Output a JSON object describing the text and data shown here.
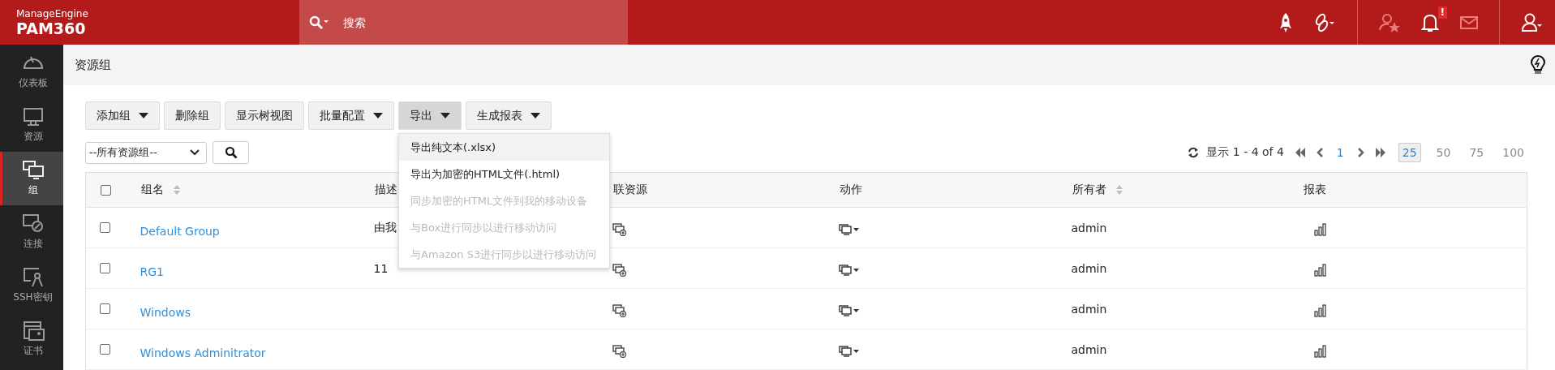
{
  "header": {
    "brand": "ManageEngine",
    "product": "PAM360",
    "search": {
      "placeholder": "搜索"
    },
    "alert_badge": "!"
  },
  "sidebar": {
    "items": [
      {
        "label": "仪表板",
        "selected": false
      },
      {
        "label": "资源",
        "selected": false
      },
      {
        "label": "组",
        "selected": true
      },
      {
        "label": "连接",
        "selected": false
      },
      {
        "label": "SSH密钥",
        "selected": false
      },
      {
        "label": "证书",
        "selected": false
      }
    ]
  },
  "page": {
    "title": "资源组"
  },
  "toolbar": {
    "buttons": [
      {
        "label": "添加组",
        "dropdown": true,
        "selected": false
      },
      {
        "label": "删除组",
        "dropdown": false,
        "selected": false
      },
      {
        "label": "显示树视图",
        "dropdown": false,
        "selected": false
      },
      {
        "label": "批量配置",
        "dropdown": true,
        "selected": false
      },
      {
        "label": "导出",
        "dropdown": true,
        "selected": true
      },
      {
        "label": "生成报表",
        "dropdown": true,
        "selected": false
      }
    ]
  },
  "export_menu": {
    "items": [
      {
        "label": "导出纯文本(.xlsx)",
        "disabled": false,
        "selected": true
      },
      {
        "label": "导出为加密的HTML文件(.html)",
        "disabled": false,
        "selected": false
      },
      {
        "label": "同步加密的HTML文件到我的移动设备",
        "disabled": true,
        "selected": false
      },
      {
        "label": "与Box进行同步以进行移动访问",
        "disabled": true,
        "selected": false
      },
      {
        "label": "与Amazon S3进行同步以进行移动访问",
        "disabled": true,
        "selected": false
      }
    ]
  },
  "filter": {
    "value": "--所有资源组--"
  },
  "pagination": {
    "range": "显示 1 - 4 of 4",
    "page": "1",
    "page_sizes": [
      {
        "label": "25",
        "selected": true
      },
      {
        "label": "50",
        "selected": false
      },
      {
        "label": "75",
        "selected": false
      },
      {
        "label": "100",
        "selected": false
      }
    ]
  },
  "table": {
    "select_all_checked": false,
    "columns": [
      {
        "label": "组名",
        "sortable": true
      },
      {
        "label": "描述",
        "sortable": false
      },
      {
        "label": "联资源",
        "sortable": false
      },
      {
        "label": "动作",
        "sortable": false
      },
      {
        "label": "所有者",
        "sortable": true
      },
      {
        "label": "报表",
        "sortable": false
      }
    ],
    "rows": [
      {
        "checked": false,
        "name": "Default Group",
        "description": "由我",
        "owner": "admin"
      },
      {
        "checked": false,
        "name": "RG1",
        "description": "11",
        "owner": "admin"
      },
      {
        "checked": false,
        "name": "Windows",
        "owner": "admin"
      },
      {
        "checked": false,
        "name": "Windows Adminitrator",
        "owner": "admin"
      }
    ]
  }
}
